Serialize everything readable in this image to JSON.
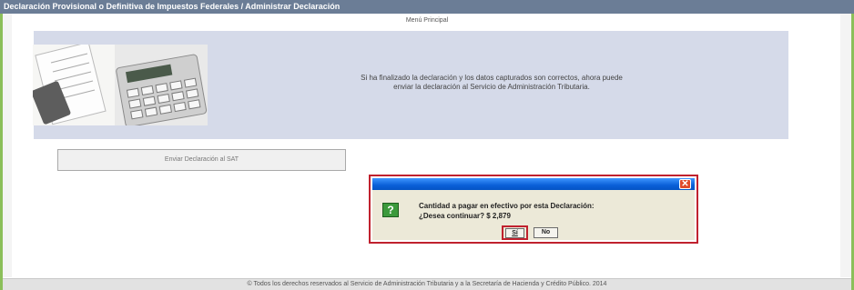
{
  "header": {
    "title": "Declaración Provisional o Definitiva de Impuestos Federales / Administrar Declaración",
    "menu_link": "Menú Principal"
  },
  "info_panel": {
    "message": "Si ha finalizado la declaración y los datos capturados son correctos, ahora puede enviar la declaración al Servicio de Administración Tributaria.",
    "image_icon": "calculator-and-receipts-image"
  },
  "actions": {
    "send_label": "Enviar Declaración al SAT"
  },
  "dialog": {
    "close_glyph": "✕",
    "icon_glyph": "?",
    "line1": "Cantidad a pagar en efectivo por esta Declaración:",
    "line2": "¿Desea continuar? $ 2,879",
    "yes_label": "Sí",
    "no_label": "No"
  },
  "footer": {
    "text": "© Todos los derechos reservados al Servicio de Administración Tributaria y a la Secretaría de Hacienda y Crédito Público. 2014"
  },
  "colors": {
    "title_bar": "#6b7d96",
    "panel": "#d5dae9",
    "frame_border": "#8bbf5a",
    "highlight": "#c0212e",
    "dialog_titlebar": "#0a5fd8"
  }
}
